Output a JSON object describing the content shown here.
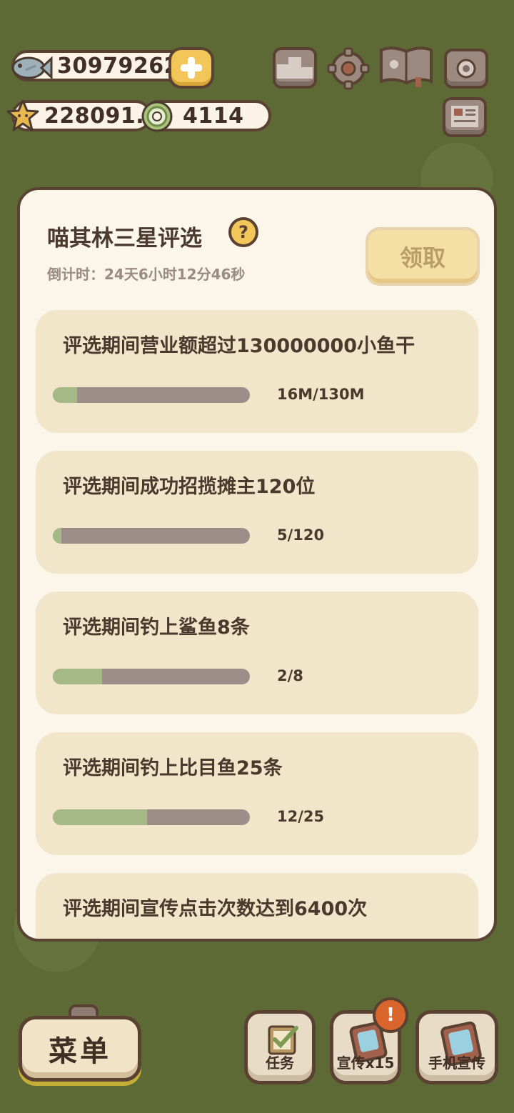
{
  "resources": {
    "fish_coins": "30979262",
    "stars": "228091.5",
    "gems": "4114"
  },
  "top_icons": [
    "ranking-icon",
    "settings-gear-icon",
    "guide-book-icon",
    "camera-icon",
    "newspaper-icon"
  ],
  "panel": {
    "title": "喵其林三星评选",
    "help_label": "?",
    "countdown": "倒计时：24天6小时12分46秒",
    "claim_label": "领取",
    "tasks": [
      {
        "title": "评选期间营业额超过130000000小鱼干",
        "progress_text": "16M/130M",
        "progress": 0.123
      },
      {
        "title": "评选期间成功招揽摊主120位",
        "progress_text": "5/120",
        "progress": 0.042
      },
      {
        "title": "评选期间钓上鲨鱼8条",
        "progress_text": "2/8",
        "progress": 0.25
      },
      {
        "title": "评选期间钓上比目鱼25条",
        "progress_text": "12/25",
        "progress": 0.48
      },
      {
        "title": "评选期间宣传点击次数达到6400次",
        "progress_text": "",
        "progress": 0
      }
    ]
  },
  "bottom_bar": {
    "menu_label": "菜单",
    "tasks_label": "任务",
    "promo_label": "宣传x15",
    "promo_badge": "!",
    "phone_promo_label": "手机宣传"
  },
  "colors": {
    "background": "#5e6a36",
    "panel": "#fbf5ea",
    "card": "#f1e6c9",
    "progress_fill": "#a5b987",
    "progress_track": "#9d8d88",
    "outline": "#5a4232",
    "accent_yellow": "#f2c659"
  }
}
